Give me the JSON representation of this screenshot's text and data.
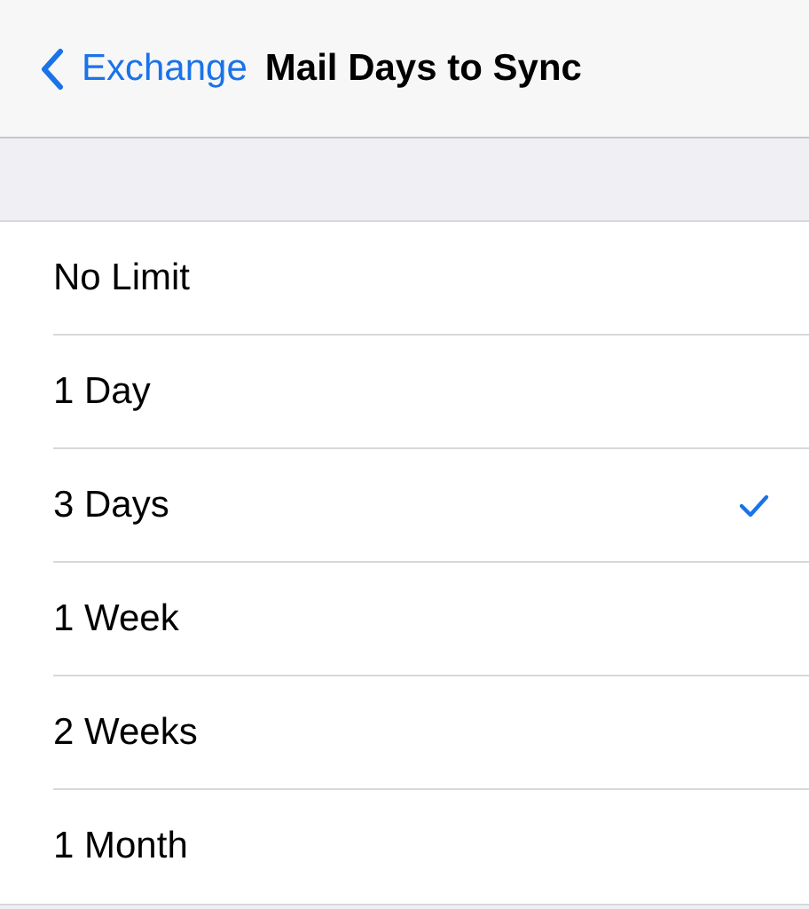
{
  "nav_bar": {
    "back_label": "Exchange",
    "title": "Mail Days to Sync"
  },
  "options": [
    {
      "label": "No Limit",
      "selected": false
    },
    {
      "label": "1 Day",
      "selected": false
    },
    {
      "label": "3 Days",
      "selected": true
    },
    {
      "label": "1 Week",
      "selected": false
    },
    {
      "label": "2 Weeks",
      "selected": false
    },
    {
      "label": "1 Month",
      "selected": false
    }
  ]
}
